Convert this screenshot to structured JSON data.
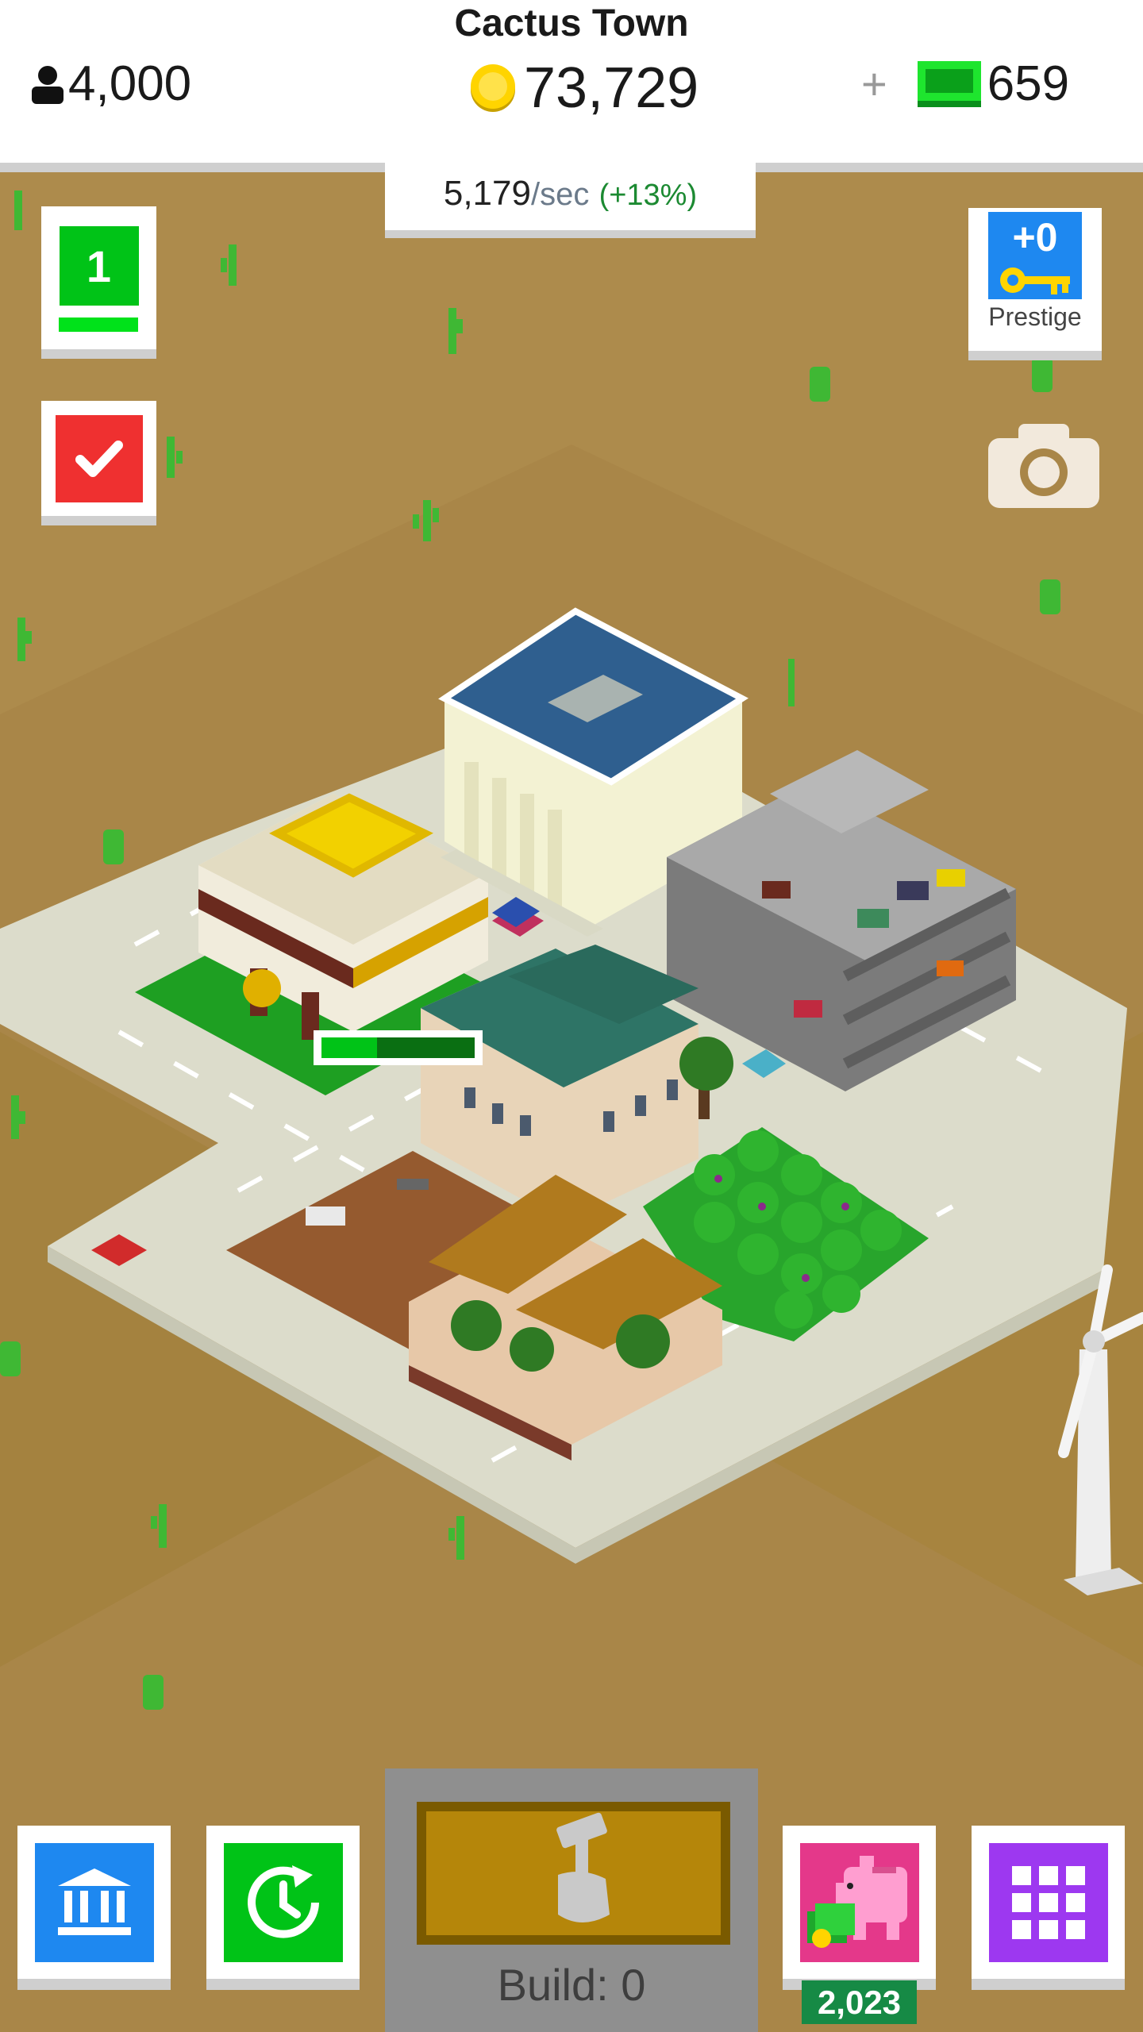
{
  "header": {
    "town_name": "Cactus Town",
    "population": "4,000",
    "coins": "73,729",
    "cash_plus": "+",
    "cash": "659",
    "rate_value": "5,179",
    "rate_unit": "/sec",
    "rate_bonus": "(+13%)"
  },
  "left_panel": {
    "level": "1"
  },
  "right_panel": {
    "prestige_value": "+0",
    "prestige_label": "Prestige"
  },
  "bottom_bar": {
    "build_label": "Build: 0",
    "piggy_count": "2,023"
  },
  "icons": {
    "population": "person-icon",
    "coins": "coin-icon",
    "cash": "cash-icon",
    "tasks": "checkmark-icon",
    "prestige": "key-icon",
    "camera": "camera-icon",
    "bank": "bank-icon",
    "timewarp": "clock-refresh-icon",
    "build": "hammer-hand-icon",
    "piggy": "piggy-bank-icon",
    "menu": "grid-icon"
  },
  "colors": {
    "ground": "#a98648",
    "level_green": "#00c317",
    "tasks_red": "#ef3030",
    "prestige_blue": "#1e88f0",
    "piggy_pink": "#e4388a",
    "grid_purple": "#9d38f0",
    "progress_green": "#00c317"
  }
}
